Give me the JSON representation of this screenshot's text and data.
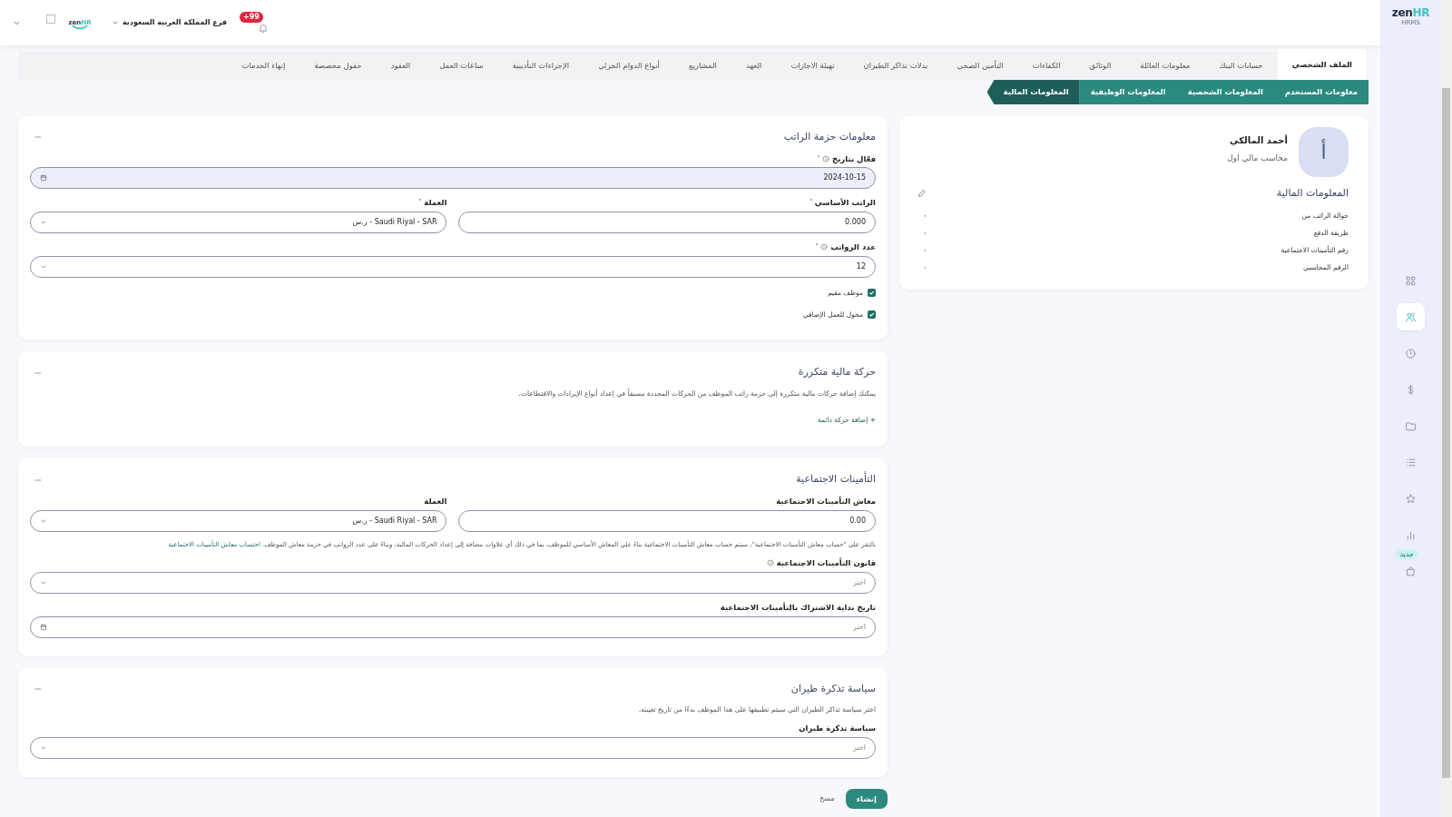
{
  "header": {
    "logo": {
      "text": "zen",
      "accent": "HR"
    },
    "branch": "فرع المملكة العربية السعودية",
    "notification_count": "+99"
  },
  "sidebar": {
    "logo": {
      "text": "zen",
      "accent": "HR",
      "caption": "HRMS"
    },
    "items": [
      {
        "kind": "grid",
        "selected": false
      },
      {
        "kind": "people",
        "selected": true
      },
      {
        "kind": "clock",
        "selected": false
      },
      {
        "kind": "dollar",
        "selected": false
      },
      {
        "kind": "folder",
        "selected": false
      },
      {
        "kind": "list",
        "selected": false
      },
      {
        "kind": "star",
        "selected": false
      },
      {
        "kind": "chart",
        "selected": false
      },
      {
        "kind": "bag",
        "selected": false,
        "badge": "جديد"
      }
    ]
  },
  "tabs": [
    {
      "label": "الملف الشخصي",
      "selected": true
    },
    {
      "label": "حسابات البنك",
      "selected": false
    },
    {
      "label": "معلومات العائلة",
      "selected": false
    },
    {
      "label": "الوثائق",
      "selected": false
    },
    {
      "label": "الكفاءات",
      "selected": false
    },
    {
      "label": "التأمين الصحي",
      "selected": false
    },
    {
      "label": "بدلات تذاكر الطيران",
      "selected": false
    },
    {
      "label": "تهيئة الاجازات",
      "selected": false
    },
    {
      "label": "العهد",
      "selected": false
    },
    {
      "label": "المشاريع",
      "selected": false
    },
    {
      "label": "أنواع الدوام الجزئي",
      "selected": false
    },
    {
      "label": "الإجراءات التأديبية",
      "selected": false
    },
    {
      "label": "ساعات العمل",
      "selected": false
    },
    {
      "label": "العقود",
      "selected": false
    },
    {
      "label": "حقول مخصصة",
      "selected": false
    },
    {
      "label": "إنهاء الخدمات",
      "selected": false
    }
  ],
  "subtabs": [
    {
      "label": "معلومات المستخدم",
      "selected": false
    },
    {
      "label": "المعلومات الشخصية",
      "selected": false
    },
    {
      "label": "المعلومات الوظيفية",
      "selected": false
    },
    {
      "label": "المعلومات المالية",
      "selected": true
    }
  ],
  "profile": {
    "initial": "أ",
    "name": "أحمد المالكي",
    "job_title": "محاسب مالي اول",
    "section_title": "المعلومات المالية",
    "fields": [
      {
        "label": "حوالة الراتب من",
        "value": "-"
      },
      {
        "label": "طريقة الدفع",
        "value": "-"
      },
      {
        "label": "رقم التأمينات الاجتماعية",
        "value": "-"
      },
      {
        "label": "الرقم المحاسبي",
        "value": "-"
      }
    ]
  },
  "sections": [
    {
      "title": "معلومات حزمة الراتب",
      "rows": [
        [
          {
            "kind": "date",
            "label": "فعّال بتاريخ",
            "info": true,
            "required": true,
            "value": "2024-10-15",
            "disabled": true
          }
        ],
        [
          {
            "kind": "input",
            "label": "الراتب الأساسي",
            "required": true,
            "value": "0.000"
          },
          {
            "kind": "select",
            "label": "العملة",
            "required": true,
            "value": "Saudi Riyal - SAR - ر.س"
          }
        ],
        [
          {
            "kind": "select",
            "label": "عدد الرواتب",
            "info": true,
            "required": true,
            "value": "12"
          }
        ],
        [
          {
            "kind": "checkbox",
            "label": "موظف مقيم",
            "checked": true
          }
        ],
        [
          {
            "kind": "checkbox",
            "label": "مخول للعمل الإضافي",
            "checked": true
          }
        ]
      ]
    },
    {
      "title": "حركة مالية متكررة",
      "rows": [
        [
          {
            "kind": "text",
            "text": "يمكنك إضافة حركات مالية متكررة إلى حزمة راتب الموظف من الحركات المحددة مسبقاً في إعداد أنواع الإيرادات والاقتطاعات."
          }
        ],
        [
          {
            "kind": "link",
            "text": "+ إضافة حركة دائمة"
          }
        ]
      ]
    },
    {
      "title": "التأمينات الاجتماعية",
      "rows": [
        [
          {
            "kind": "input",
            "label": "معاش التأمينات الاجتماعية",
            "value": "0.00"
          },
          {
            "kind": "select",
            "label": "العملة",
            "value": "Saudi Riyal - SAR - ر.س"
          }
        ],
        [
          {
            "kind": "note",
            "text": "بالنقر على \"حساب معاش التأمينات الاجتماعية\"، سيتم حساب معاش التأمينات الاجتماعية بناءً على المعاش الأساسي للموظف، بما في ذلك أي علاوات مضافة إلى إعداد الحركات المالية، وبناءً على عدد الرواتب في حزمة معاش الموظف.",
            "link": "احتساب معاش التأمينات الاجتماعية"
          }
        ],
        [
          {
            "kind": "select",
            "label": "قانون التأمينات الاجتماعية",
            "info": true,
            "placeholder": "اختر"
          }
        ],
        [
          {
            "kind": "date",
            "label": "تاريخ بداية الاشتراك بالتأمينات الاجتماعية",
            "placeholder": "اختر"
          }
        ]
      ]
    },
    {
      "title": "سياسة تذكرة طيران",
      "rows": [
        [
          {
            "kind": "text",
            "text": "اختر سياسة تذاكر الطيران التي سيتم تطبيقها على هذا الموظف بدءًا من تاريخ تعيينه."
          }
        ],
        [
          {
            "kind": "select",
            "label": "سياسة تذكرة طيران",
            "placeholder": "اختر"
          }
        ]
      ]
    }
  ],
  "actions": [
    {
      "kind": "primary",
      "label": "إنشاء"
    },
    {
      "kind": "secondary",
      "label": "مسح"
    }
  ]
}
